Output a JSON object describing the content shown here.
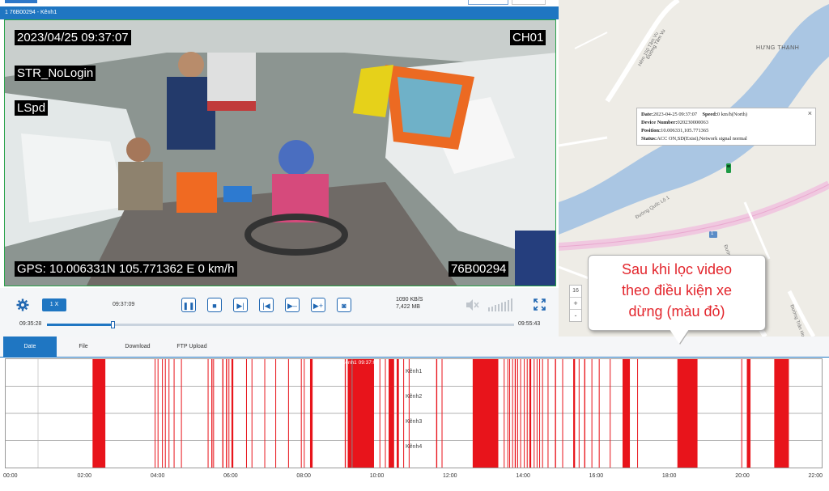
{
  "player": {
    "title": "1  76B00294 - Kênh1",
    "osd": {
      "datetime": "2023/04/25  09:37:07",
      "channel": "CH01",
      "login": "STR_NoLogin",
      "speed_tag": "LSpd",
      "gps": "GPS: 10.006331N  105.771362 E    0 km/h",
      "plate": "76B00294"
    },
    "controls": {
      "speed": "1 X",
      "current_time": "09:37:09",
      "bitrate": "1090 KB/S",
      "size": "7,422 MB",
      "range_start": "09:35:28",
      "range_end": "09:55:43",
      "progress": 0.14
    }
  },
  "tabs": [
    {
      "label": "Date",
      "active": true
    },
    {
      "label": "File",
      "active": false
    },
    {
      "label": "Download",
      "active": false
    },
    {
      "label": "FTP Upload",
      "active": false
    }
  ],
  "timeline": {
    "rows": [
      "Kênh1",
      "Kênh2",
      "Kênh3",
      "Kênh4"
    ],
    "cursor_label": "Kênh1 09:37:07",
    "cursor_time": 9.3,
    "ticks": [
      "00:00",
      "02:00",
      "04:00",
      "06:00",
      "08:00",
      "10:00",
      "12:00",
      "14:00",
      "16:00",
      "18:00",
      "20:00",
      "22:00"
    ],
    "segments": [
      [
        2.2,
        2.55
      ],
      [
        3.9,
        3.92
      ],
      [
        3.98,
        4.0
      ],
      [
        4.1,
        4.12
      ],
      [
        4.18,
        4.2
      ],
      [
        4.28,
        4.3
      ],
      [
        4.42,
        4.44
      ],
      [
        4.62,
        4.64
      ],
      [
        5.35,
        5.37
      ],
      [
        5.45,
        5.48
      ],
      [
        5.5,
        5.52
      ],
      [
        5.75,
        5.78
      ],
      [
        5.85,
        5.88
      ],
      [
        5.92,
        5.94
      ],
      [
        6.0,
        6.05
      ],
      [
        6.4,
        6.42
      ],
      [
        6.55,
        6.57
      ],
      [
        6.9,
        6.92
      ],
      [
        7.2,
        7.22
      ],
      [
        7.55,
        7.57
      ],
      [
        7.9,
        7.92
      ],
      [
        7.98,
        8.0
      ],
      [
        8.15,
        8.22
      ],
      [
        9.1,
        9.13
      ],
      [
        9.18,
        9.9
      ],
      [
        10.05,
        10.07
      ],
      [
        10.2,
        10.22
      ],
      [
        10.3,
        10.45
      ],
      [
        10.52,
        10.58
      ],
      [
        10.7,
        10.72
      ],
      [
        10.85,
        10.87
      ],
      [
        11.6,
        11.63
      ],
      [
        11.75,
        11.77
      ],
      [
        12.6,
        13.3
      ],
      [
        13.45,
        13.47
      ],
      [
        13.55,
        13.57
      ],
      [
        13.6,
        13.62
      ],
      [
        13.68,
        13.7
      ],
      [
        13.75,
        13.78
      ],
      [
        13.82,
        13.84
      ],
      [
        13.9,
        13.92
      ],
      [
        14.0,
        14.02
      ],
      [
        14.08,
        14.1
      ],
      [
        14.15,
        14.2
      ],
      [
        14.27,
        14.29
      ],
      [
        14.35,
        14.37
      ],
      [
        14.42,
        14.44
      ],
      [
        14.5,
        14.52
      ],
      [
        14.65,
        14.67
      ],
      [
        14.85,
        14.88
      ],
      [
        15.05,
        15.07
      ],
      [
        15.35,
        15.4
      ],
      [
        15.5,
        15.52
      ],
      [
        15.65,
        15.68
      ],
      [
        15.85,
        15.87
      ],
      [
        16.05,
        16.07
      ],
      [
        16.35,
        16.37
      ],
      [
        16.7,
        16.9
      ],
      [
        17.1,
        17.12
      ],
      [
        18.2,
        18.75
      ],
      [
        19.95,
        19.97
      ],
      [
        20.1,
        20.2
      ],
      [
        20.85,
        21.25
      ]
    ],
    "segment_color": "#e8141b"
  },
  "map": {
    "labels": {
      "road1": "Hẻm 150 Tầm Vu",
      "road2": "Đường Tầm Vu",
      "district": "HƯNG THẠNH",
      "highway": "Đường Quốc Lộ 1",
      "road3": "Đường Trần Hoàng Na",
      "road4": "Đường Trần Hoàng",
      "route_no": "1",
      "zoom_level": "16",
      "zoom_in": "+",
      "zoom_out": "-"
    },
    "popup": {
      "date_label": "Date:",
      "date_value": "2023-04-25 09:37:07",
      "speed_label": "Speed:",
      "speed_value": "0 km/h(North)",
      "device_label": "Device Number:",
      "device_value": "020230000063",
      "position_label": "Position:",
      "position_value": "10.006331,105.771365",
      "status_label": "Status:",
      "status_value": "ACC ON,SD(Exist),Network signal normal",
      "close": "×"
    }
  },
  "annotation": {
    "line1": "Sau khi lọc video",
    "line2": "theo điều kiện xe",
    "line3": "dừng (màu đỏ)"
  },
  "colors": {
    "accent": "#1f76c2",
    "record": "#e8141b",
    "annotation_text": "#e3262d"
  }
}
